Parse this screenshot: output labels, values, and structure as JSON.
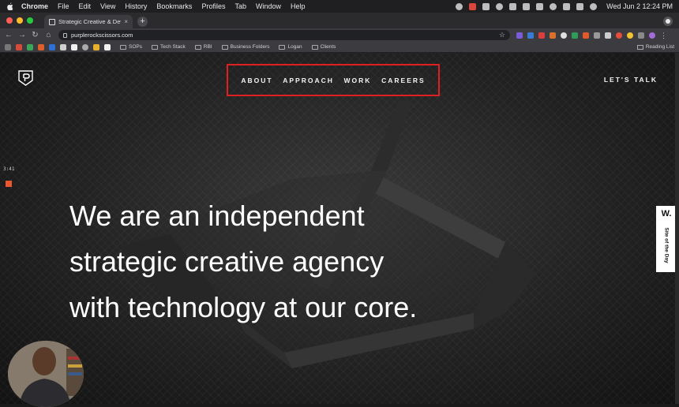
{
  "menubar": {
    "app": "Chrome",
    "items": [
      "File",
      "Edit",
      "View",
      "History",
      "Bookmarks",
      "Profiles",
      "Tab",
      "Window",
      "Help"
    ],
    "clock": "Wed Jun 2  12:24 PM"
  },
  "browser": {
    "tab_title": "Strategic Creative & Developm",
    "tab_close": "×",
    "new_tab": "+",
    "url": "purplerockscissors.com",
    "bookmark_folders": [
      "SOPs",
      "Tech Stack",
      "RBI",
      "Business Folders",
      "Logan",
      "Clients"
    ],
    "reading_list": "Reading List"
  },
  "site": {
    "nav": [
      "ABOUT",
      "APPROACH",
      "WORK",
      "CAREERS"
    ],
    "cta": "LET'S TALK",
    "hero_lines": [
      "We are an independent",
      "strategic creative agency",
      "with technology at our core."
    ],
    "award_mark": "W.",
    "award_label": "Site of the Day"
  },
  "overlay": {
    "timer": "3:41"
  },
  "colors": {
    "highlight_box": "#e02020",
    "record_indicator": "#e8582c",
    "page_background": "#1a1a1a"
  }
}
